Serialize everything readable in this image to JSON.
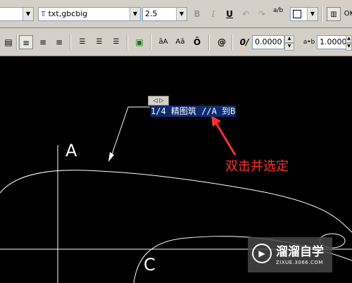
{
  "toolbar_top": {
    "style_value": "",
    "font_value": "txt,gbcbig",
    "height_value": "2.5",
    "bold_label": "B",
    "italic_label": "I",
    "underline_label": "U",
    "stack_label": "a/b",
    "ok_label": "OK"
  },
  "toolbar_bottom": {
    "oblique_value": "0.0000",
    "tracking_value": "1.0000",
    "symbol_label": "@",
    "oblique_label": "0/",
    "tracking_label": "a•b"
  },
  "drawing": {
    "label_a": "A",
    "label_c": "C",
    "mtext_content": "1/4 精图筑  //A 到B",
    "ruler_label": "◁ ▷",
    "annotation": "双击并选定"
  },
  "watermark": {
    "title": "溜溜自学",
    "url": "ZIXUE.3066.COM"
  },
  "colors": {
    "canvas": "#000000",
    "annotation": "#ff3030",
    "mtext_bg": "#102a6e",
    "toolbar": "#d4d0c8"
  }
}
